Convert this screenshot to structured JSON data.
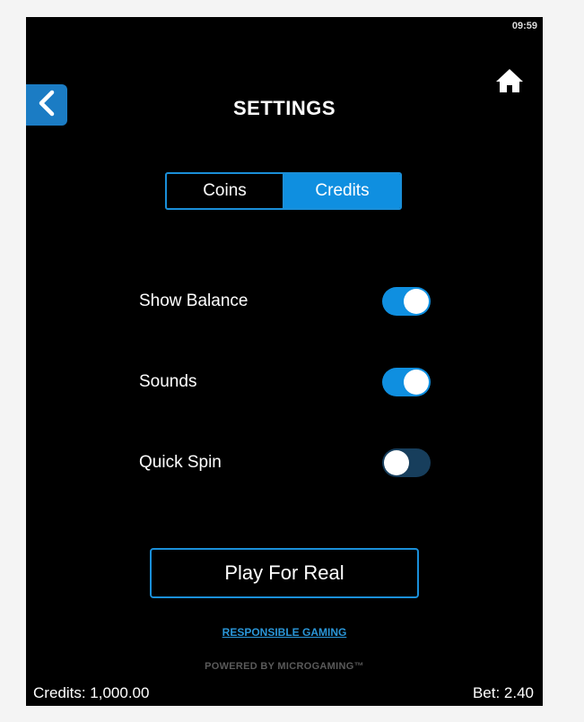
{
  "status": {
    "time": "09:59"
  },
  "header": {
    "title": "SETTINGS",
    "back_icon": "chevron-left-icon",
    "home_icon": "home-icon"
  },
  "display_mode": {
    "options": [
      "Coins",
      "Credits"
    ],
    "selected": "Credits"
  },
  "settings": [
    {
      "label": "Show Balance",
      "enabled": true
    },
    {
      "label": "Sounds",
      "enabled": true
    },
    {
      "label": "Quick Spin",
      "enabled": false
    }
  ],
  "actions": {
    "play_for_real": "Play For Real",
    "responsible_gaming": "RESPONSIBLE GAMING",
    "powered_by": "POWERED BY MICROGAMING™"
  },
  "footer": {
    "credits": "Credits: 1,000.00",
    "bet": "Bet: 2.40"
  },
  "colors": {
    "background": "#000000",
    "accent": "#0f8fe0",
    "back_button": "#1b7cc4",
    "toggle_off": "#173e5c",
    "link": "#2a96d8"
  }
}
